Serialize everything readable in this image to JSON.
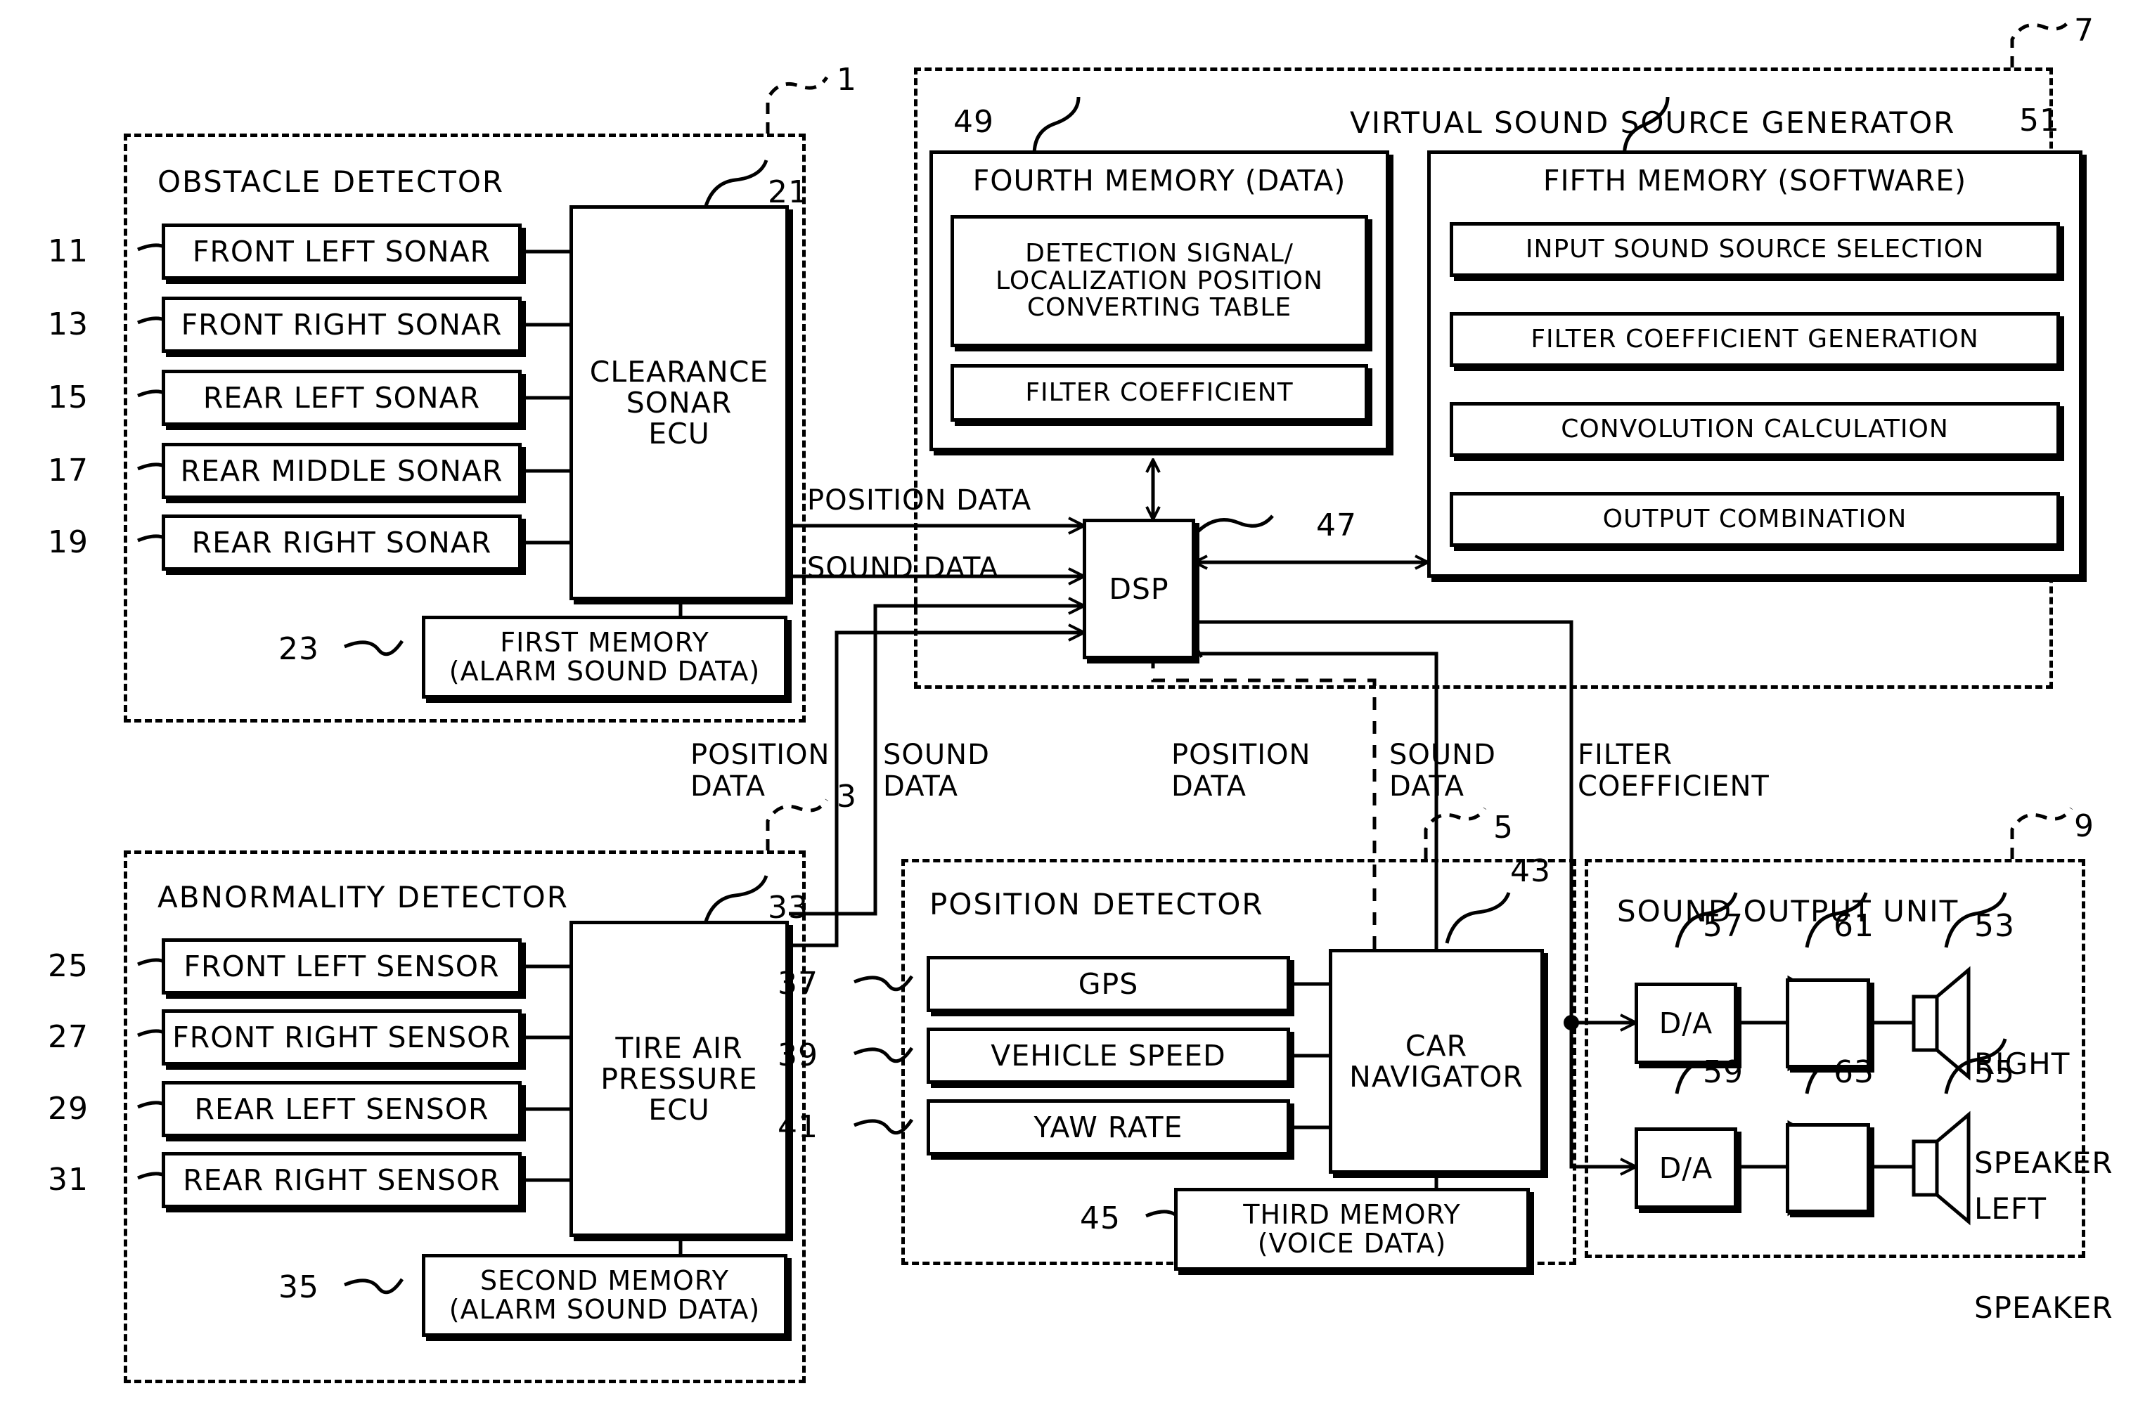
{
  "figure": {
    "groups": [
      {
        "id": "obstacle",
        "title": "OBSTACLE DETECTOR",
        "ref": "1"
      },
      {
        "id": "vsg",
        "title": "VIRTUAL SOUND SOURCE GENERATOR",
        "ref": "7"
      },
      {
        "id": "abnormal",
        "title": "ABNORMALITY DETECTOR",
        "ref": "3"
      },
      {
        "id": "position",
        "title": "POSITION DETECTOR",
        "ref": "5"
      },
      {
        "id": "output",
        "title": "SOUND OUTPUT UNIT",
        "ref": "9"
      }
    ],
    "obstacle_detector": {
      "sonars": [
        {
          "ref": "11",
          "label": "FRONT LEFT SONAR"
        },
        {
          "ref": "13",
          "label": "FRONT RIGHT SONAR"
        },
        {
          "ref": "15",
          "label": "REAR LEFT SONAR"
        },
        {
          "ref": "17",
          "label": "REAR MIDDLE SONAR"
        },
        {
          "ref": "19",
          "label": "REAR RIGHT SONAR"
        }
      ],
      "ecu": {
        "ref": "21",
        "line1": "CLEARANCE",
        "line2": "SONAR",
        "line3": "ECU"
      },
      "memory": {
        "ref": "23",
        "line1": "FIRST MEMORY",
        "line2": "(ALARM SOUND DATA)"
      }
    },
    "abnormality_detector": {
      "sensors": [
        {
          "ref": "25",
          "label": "FRONT LEFT SENSOR"
        },
        {
          "ref": "27",
          "label": "FRONT RIGHT SENSOR"
        },
        {
          "ref": "29",
          "label": "REAR LEFT SENSOR"
        },
        {
          "ref": "31",
          "label": "REAR RIGHT SENSOR"
        }
      ],
      "ecu": {
        "ref": "33",
        "line1": "TIRE AIR",
        "line2": "PRESSURE",
        "line3": "ECU"
      },
      "memory": {
        "ref": "35",
        "line1": "SECOND MEMORY",
        "line2": "(ALARM SOUND DATA)"
      }
    },
    "position_detector": {
      "sources": [
        {
          "ref": "37",
          "label": "GPS"
        },
        {
          "ref": "39",
          "label": "VEHICLE SPEED"
        },
        {
          "ref": "41",
          "label": "YAW RATE"
        }
      ],
      "navigator": {
        "ref": "43",
        "line1": "CAR",
        "line2": "NAVIGATOR"
      },
      "memory": {
        "ref": "45",
        "line1": "THIRD MEMORY",
        "line2": "(VOICE DATA)"
      }
    },
    "virtual_sound_source_generator": {
      "dsp": {
        "ref": "47",
        "label": "DSP"
      },
      "fourth_memory": {
        "ref": "49",
        "title": "FOURTH MEMORY (DATA)",
        "items": [
          {
            "line1": "DETECTION SIGNAL/",
            "line2": "LOCALIZATION POSITION",
            "line3": "CONVERTING TABLE"
          },
          {
            "line1": "FILTER COEFFICIENT"
          }
        ]
      },
      "fifth_memory": {
        "ref": "51",
        "title": "FIFTH MEMORY (SOFTWARE)",
        "items": [
          "INPUT SOUND SOURCE SELECTION",
          "FILTER COEFFICIENT GENERATION",
          "CONVOLUTION CALCULATION",
          "OUTPUT COMBINATION"
        ]
      }
    },
    "sound_output_unit": {
      "channels": [
        {
          "da": {
            "ref": "57",
            "label": "D/A"
          },
          "amp": {
            "ref": "61"
          },
          "speaker": {
            "ref": "53",
            "line1": "RIGHT",
            "line2": "SPEAKER"
          }
        },
        {
          "da": {
            "ref": "59",
            "label": "D/A"
          },
          "amp": {
            "ref": "63"
          },
          "speaker": {
            "ref": "55",
            "line1": "LEFT",
            "line2": "SPEAKER"
          }
        }
      ]
    },
    "wire_labels": {
      "position_data_top": "POSITION DATA",
      "sound_data_top": "SOUND DATA",
      "position_data_left": "POSITION\nDATA",
      "sound_data_left": "SOUND\nDATA",
      "position_data_mid": "POSITION\nDATA",
      "sound_data_mid": "SOUND\nDATA",
      "filter_coefficient": "FILTER\nCOEFFICIENT"
    }
  }
}
